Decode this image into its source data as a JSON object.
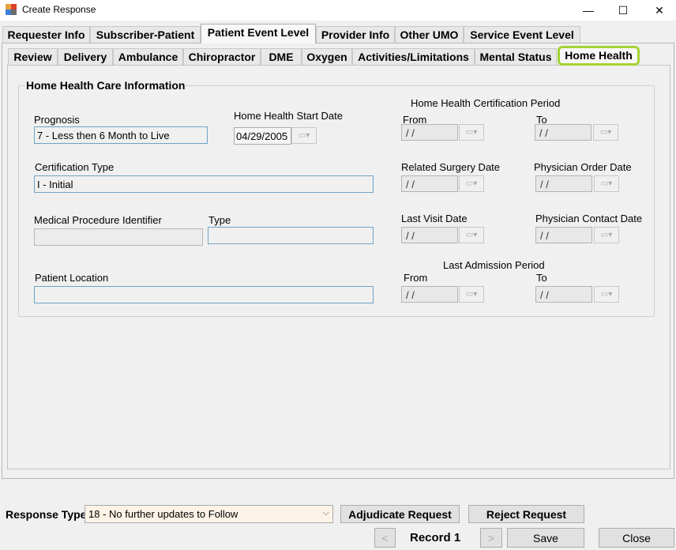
{
  "window": {
    "title": "Create Response",
    "minimize": "—",
    "maximize": "☐",
    "close": "✕"
  },
  "outer_tabs": [
    "Requester Info",
    "Subscriber-Patient",
    "Patient Event Level",
    "Provider Info",
    "Other UMO",
    "Service Event Level"
  ],
  "inner_tabs": [
    "Review",
    "Delivery",
    "Ambulance",
    "Chiropractor",
    "DME",
    "Oxygen",
    "Activities/Limitations",
    "Mental Status",
    "Home Health"
  ],
  "group": {
    "title": "Home Health Care Information",
    "prognosis_label": "Prognosis",
    "prognosis_value": "7 - Less then 6 Month to Live",
    "start_date_label": "Home Health Start Date",
    "start_date_value": "04/29/2005",
    "cert_type_label": "Certification Type",
    "cert_type_value": "I - Initial",
    "med_proc_label": "Medical Procedure Identifier",
    "med_proc_value": "",
    "type_label": "Type",
    "type_value": "",
    "patient_location_label": "Patient Location",
    "patient_location_value": "",
    "cert_period_label": "Home Health Certification Period",
    "from_label": "From",
    "to_label": "To",
    "related_surgery_label": "Related Surgery Date",
    "physician_order_label": "Physician Order Date",
    "last_visit_label": "Last Visit Date",
    "physician_contact_label": "Physician Contact Date",
    "last_admission_label": "Last Admission Period",
    "empty_date": " / /"
  },
  "footer": {
    "response_type_label": "Response Type",
    "response_type_value": "18 - No further updates to Follow",
    "adjudicate_label": "Adjudicate Request",
    "reject_label": "Reject Request",
    "prev_label": "<",
    "record_label": "Record 1",
    "next_label": ">",
    "save_label": "Save",
    "close_label": "Close"
  }
}
